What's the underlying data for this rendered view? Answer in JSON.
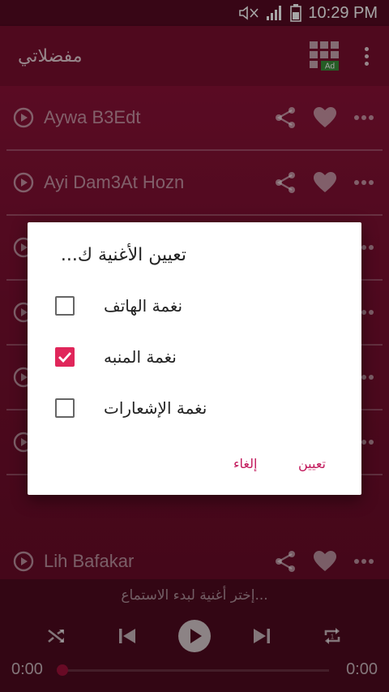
{
  "status": {
    "time": "10:29 PM"
  },
  "appbar": {
    "title": "مفضلاتي",
    "ad_badge": "Ad"
  },
  "songs": [
    {
      "name": "Aywa B3Edt"
    },
    {
      "name": "Ayi Dam3At Hozn"
    },
    {
      "name": ""
    },
    {
      "name": ""
    },
    {
      "name": ""
    },
    {
      "name": ""
    },
    {
      "name": ""
    },
    {
      "name": "Lih Bafakar"
    }
  ],
  "dialog": {
    "title": "تعيين الأغنية ك...",
    "options": [
      {
        "label": "نغمة الهاتف",
        "checked": false
      },
      {
        "label": "نغمة المنبه",
        "checked": true
      },
      {
        "label": "نغمة الإشعارات",
        "checked": false
      }
    ],
    "cancel": "إلغاء",
    "confirm": "تعيين"
  },
  "player": {
    "hint": "إختر أغنية لبدء الاستماع...",
    "elapsed": "0:00",
    "duration": "0:00",
    "progress": 0
  },
  "colors": {
    "accent": "#e0265a",
    "appbar": "#7a0f2f",
    "player": "#4f0a1f"
  }
}
